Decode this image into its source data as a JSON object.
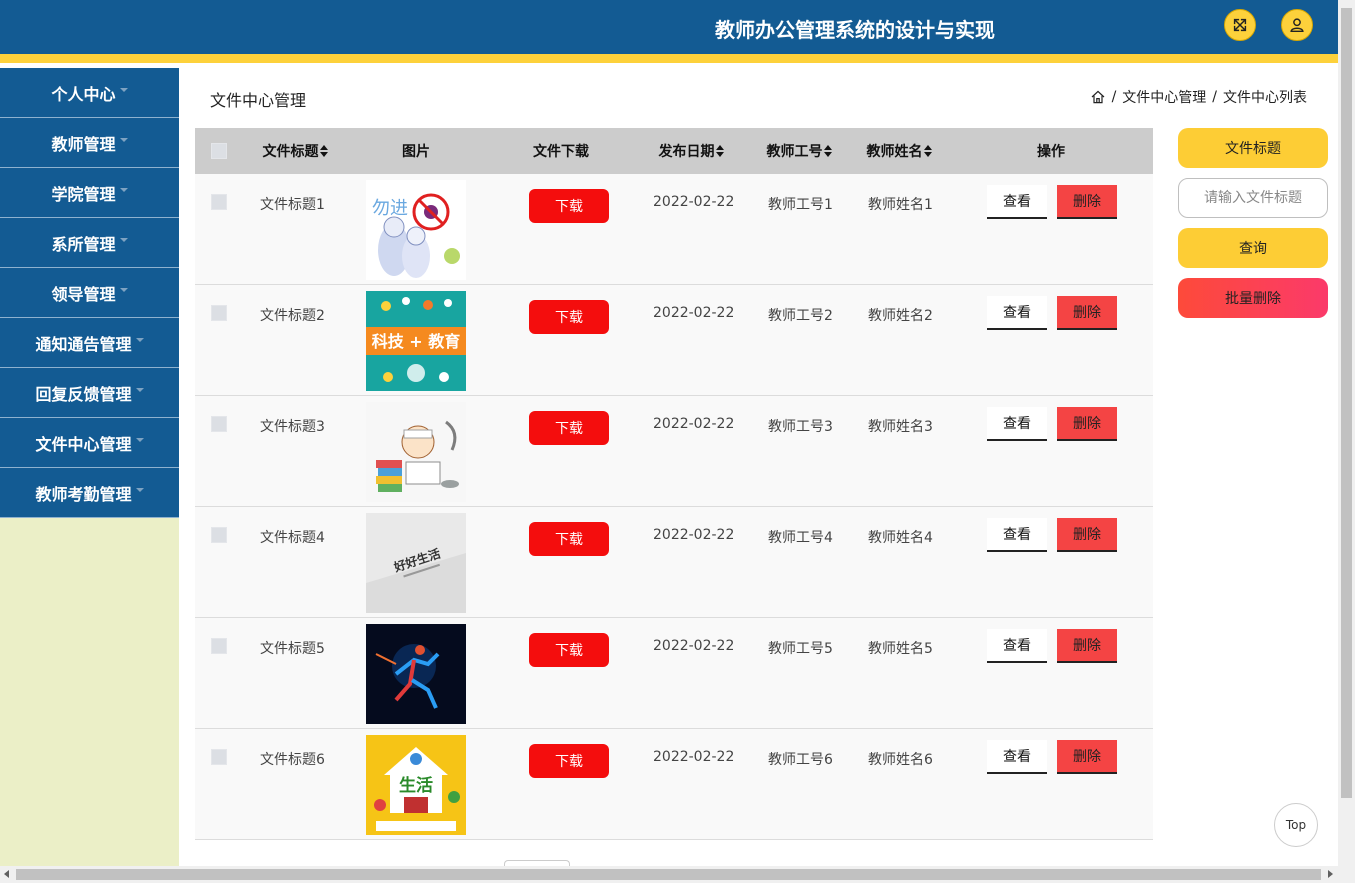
{
  "header": {
    "title": "教师办公管理系统的设计与实现"
  },
  "sidebar": {
    "items": [
      {
        "label": "个人中心"
      },
      {
        "label": "教师管理"
      },
      {
        "label": "学院管理"
      },
      {
        "label": "系所管理"
      },
      {
        "label": "领导管理"
      },
      {
        "label": "通知通告管理"
      },
      {
        "label": "回复反馈管理"
      },
      {
        "label": "文件中心管理"
      },
      {
        "label": "教师考勤管理"
      }
    ]
  },
  "page": {
    "title": "文件中心管理",
    "breadcrumb": [
      "文件中心管理",
      "文件中心列表"
    ],
    "breadcrumb_sep": "/"
  },
  "table": {
    "columns": {
      "title": "文件标题",
      "image": "图片",
      "download": "文件下载",
      "date": "发布日期",
      "teacher_id": "教师工号",
      "teacher_name": "教师姓名",
      "actions": "操作"
    },
    "download_label": "下载",
    "view_label": "查看",
    "delete_label": "删除",
    "rows": [
      {
        "title": "文件标题1",
        "date": "2022-02-22",
        "teacher_id": "教师工号1",
        "teacher_name": "教师姓名1"
      },
      {
        "title": "文件标题2",
        "date": "2022-02-22",
        "teacher_id": "教师工号2",
        "teacher_name": "教师姓名2"
      },
      {
        "title": "文件标题3",
        "date": "2022-02-22",
        "teacher_id": "教师工号3",
        "teacher_name": "教师姓名3"
      },
      {
        "title": "文件标题4",
        "date": "2022-02-22",
        "teacher_id": "教师工号4",
        "teacher_name": "教师姓名4"
      },
      {
        "title": "文件标题5",
        "date": "2022-02-22",
        "teacher_id": "教师工号5",
        "teacher_name": "教师姓名5"
      },
      {
        "title": "文件标题6",
        "date": "2022-02-22",
        "teacher_id": "教师工号6",
        "teacher_name": "教师姓名6"
      }
    ],
    "thumb_text": {
      "row1": "勿进",
      "row2": "科技 + 教育",
      "row4": "好好生活",
      "row6": "生活"
    }
  },
  "panel": {
    "field_label": "文件标题",
    "search_placeholder": "请输入文件标题",
    "query_label": "查询",
    "batch_delete_label": "批量删除"
  },
  "misc": {
    "top_label": "Top"
  },
  "colors": {
    "header": "#135b93",
    "accent": "#fdd13b",
    "download": "#f40d0d",
    "delete": "#f44444",
    "sidebar_bg": "#ebefc7"
  }
}
